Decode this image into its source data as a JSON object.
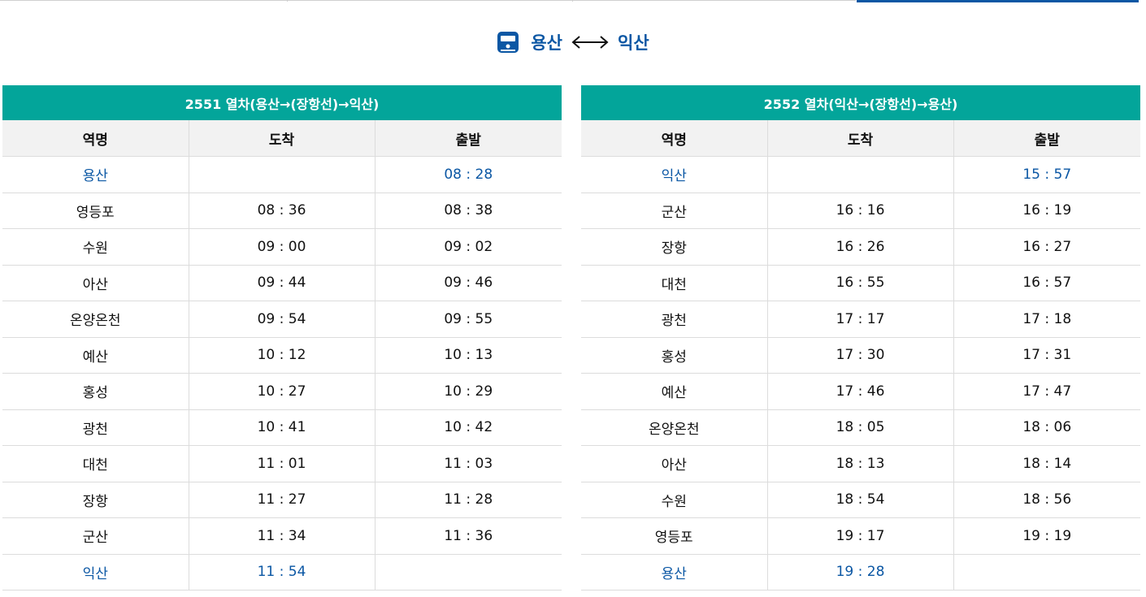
{
  "route": {
    "from": "용산",
    "to": "익산"
  },
  "colors": {
    "accent": "#03a59a",
    "link": "#0b57a4",
    "header_bg": "#f2f2f2"
  },
  "icons": {
    "train": "train-icon",
    "arrow": "double-arrow-icon"
  },
  "timetables": [
    {
      "title": "2551 열차(용산→(장항선)→익산)",
      "columns": [
        "역명",
        "도착",
        "출발"
      ],
      "rows": [
        {
          "station": "용산",
          "arrive": "",
          "depart": "08 : 28",
          "highlight": true
        },
        {
          "station": "영등포",
          "arrive": "08 : 36",
          "depart": "08 : 38"
        },
        {
          "station": "수원",
          "arrive": "09 : 00",
          "depart": "09 : 02"
        },
        {
          "station": "아산",
          "arrive": "09 : 44",
          "depart": "09 : 46"
        },
        {
          "station": "온양온천",
          "arrive": "09 : 54",
          "depart": "09 : 55"
        },
        {
          "station": "예산",
          "arrive": "10 : 12",
          "depart": "10 : 13"
        },
        {
          "station": "홍성",
          "arrive": "10 : 27",
          "depart": "10 : 29"
        },
        {
          "station": "광천",
          "arrive": "10 : 41",
          "depart": "10 : 42"
        },
        {
          "station": "대천",
          "arrive": "11 : 01",
          "depart": "11 : 03"
        },
        {
          "station": "장항",
          "arrive": "11 : 27",
          "depart": "11 : 28"
        },
        {
          "station": "군산",
          "arrive": "11 : 34",
          "depart": "11 : 36"
        },
        {
          "station": "익산",
          "arrive": "11 : 54",
          "depart": "",
          "highlight": true
        }
      ]
    },
    {
      "title": "2552 열차(익산→(장항선)→용산)",
      "columns": [
        "역명",
        "도착",
        "출발"
      ],
      "rows": [
        {
          "station": "익산",
          "arrive": "",
          "depart": "15 : 57",
          "highlight": true
        },
        {
          "station": "군산",
          "arrive": "16 : 16",
          "depart": "16 : 19"
        },
        {
          "station": "장항",
          "arrive": "16 : 26",
          "depart": "16 : 27"
        },
        {
          "station": "대천",
          "arrive": "16 : 55",
          "depart": "16 : 57"
        },
        {
          "station": "광천",
          "arrive": "17 : 17",
          "depart": "17 : 18"
        },
        {
          "station": "홍성",
          "arrive": "17 : 30",
          "depart": "17 : 31"
        },
        {
          "station": "예산",
          "arrive": "17 : 46",
          "depart": "17 : 47"
        },
        {
          "station": "온양온천",
          "arrive": "18 : 05",
          "depart": "18 : 06"
        },
        {
          "station": "아산",
          "arrive": "18 : 13",
          "depart": "18 : 14"
        },
        {
          "station": "수원",
          "arrive": "18 : 54",
          "depart": "18 : 56"
        },
        {
          "station": "영등포",
          "arrive": "19 : 17",
          "depart": "19 : 19"
        },
        {
          "station": "용산",
          "arrive": "19 : 28",
          "depart": "",
          "highlight": true
        }
      ]
    }
  ]
}
